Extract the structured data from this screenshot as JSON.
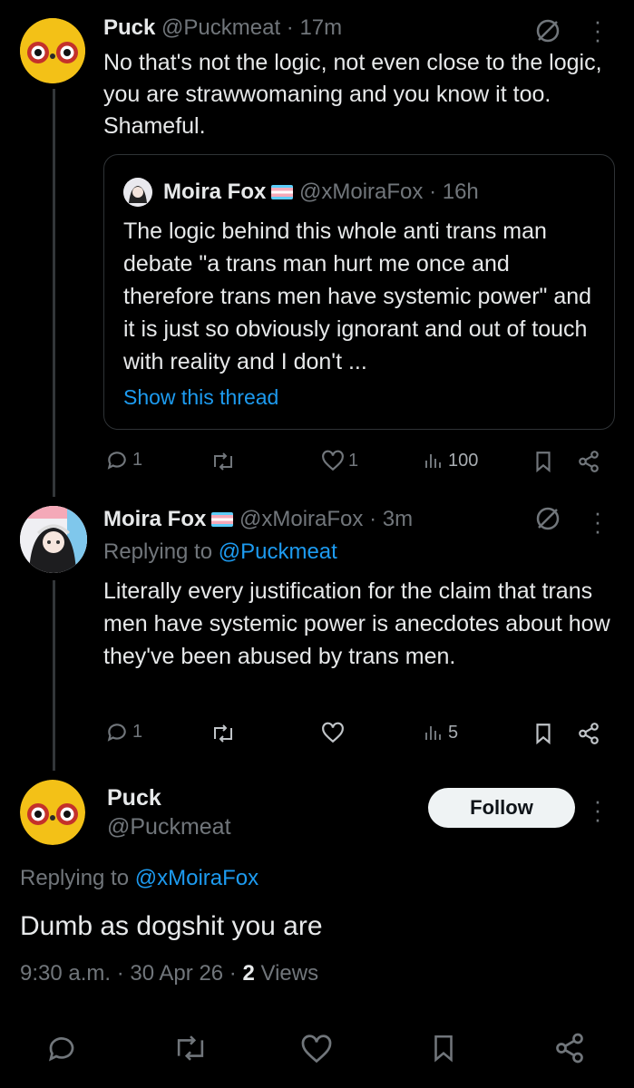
{
  "tweet1": {
    "author": "Puck",
    "handle": "@Puckmeat",
    "time": "· 17m",
    "text": "No that's not the logic, not even close to the logic, you are strawwomaning and you know it too. Shameful.",
    "quote": {
      "author": "Moira Fox",
      "handle": "@xMoiraFox",
      "time": "· 16h",
      "text": "The logic behind this whole anti trans man debate \"a trans man hurt me once and therefore trans men have systemic power\" and it is just so obviously ignorant and out of touch with reality and I don't ...",
      "show_thread": "Show this thread"
    },
    "replies": "1",
    "likes": "1",
    "views": "100"
  },
  "tweet2": {
    "author": "Moira Fox",
    "handle": "@xMoiraFox",
    "time": "· 3m",
    "replying_prefix": "Replying to",
    "replying_handle": "@Puckmeat",
    "text": "Literally every justification for the claim that trans men have systemic power is anecdotes about how they've been abused by trans men.",
    "replies": "1",
    "views": "5"
  },
  "main_tweet": {
    "author": "Puck",
    "handle": "@Puckmeat",
    "follow_label": "Follow",
    "replying_prefix": "Replying to",
    "replying_handle": "@xMoiraFox",
    "text": "Dumb as dogshit you are",
    "timestamp": "9:30 a.m. · 30 Apr 26 · ",
    "views_count": "2",
    "views_label": "Views"
  },
  "colors": {
    "background": "#000000",
    "text": "#e7e9ea",
    "muted": "#71767b",
    "link": "#1d9bf0",
    "border": "#2f3336"
  },
  "icons": [
    "no-sign-icon",
    "more-icon",
    "reply-icon",
    "retweet-icon",
    "like-icon",
    "views-icon",
    "bookmark-icon",
    "share-icon",
    "trans-flag-icon"
  ]
}
